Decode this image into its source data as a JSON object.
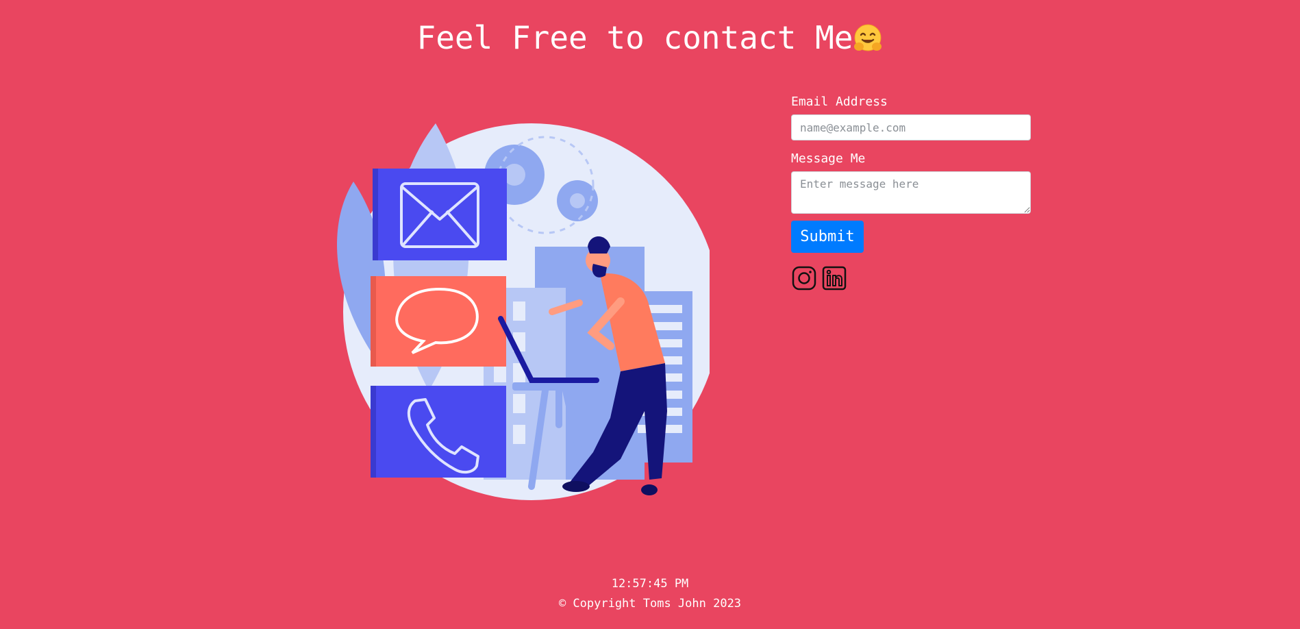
{
  "header": {
    "title": "Feel Free to contact Me"
  },
  "illustration": {
    "icons": [
      "envelope-icon",
      "speech-bubble-icon",
      "phone-icon",
      "gear-icon",
      "person-with-laptop"
    ]
  },
  "form": {
    "email_label": "Email Address",
    "email_placeholder": "name@example.com",
    "email_value": "",
    "message_label": "Message Me",
    "message_placeholder": "Enter message here",
    "message_value": "",
    "submit_label": "Submit"
  },
  "socials": [
    "instagram-icon",
    "linkedin-icon"
  ],
  "footer": {
    "time": "12:57:45 PM",
    "copyright": "© Copyright Toms John 2023"
  },
  "colors": {
    "background": "#e94560",
    "submit": "#007bff",
    "illustration_blue": "#4a4af0",
    "illustration_coral": "#ff6b5e"
  }
}
